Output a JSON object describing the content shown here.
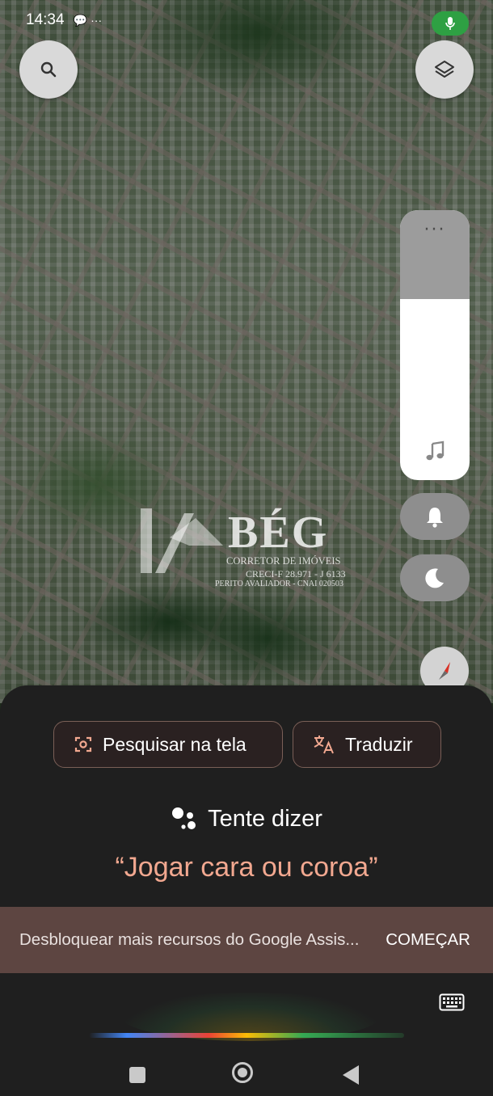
{
  "status_bar": {
    "time": "14:34",
    "extra": "💬 ···"
  },
  "map": {
    "search_icon": "search-icon",
    "layers_icon": "layers-icon",
    "watermark": {
      "brand": "BÉG",
      "line1": "CORRETOR DE IMÓVEIS",
      "line2": "CRECI-F 28.971 - J 6133",
      "line3": "PERITO AVALIADOR - CNAI 020503"
    }
  },
  "volume_panel": {
    "level": 0.67,
    "more": "···"
  },
  "assistant": {
    "chips": [
      {
        "label": "Pesquisar na tela"
      },
      {
        "label": "Traduzir"
      }
    ],
    "try_label": "Tente dizer",
    "suggestion": "“Jogar cara ou coroa”",
    "banner": {
      "text": "Desbloquear mais recursos do Google Assis...",
      "action": "COMEÇAR"
    }
  },
  "colors": {
    "accent_text": "#f2a890",
    "banner_bg": "#5d4541",
    "sheet_bg": "#1f1f1f",
    "mic_green": "#2ea043"
  }
}
